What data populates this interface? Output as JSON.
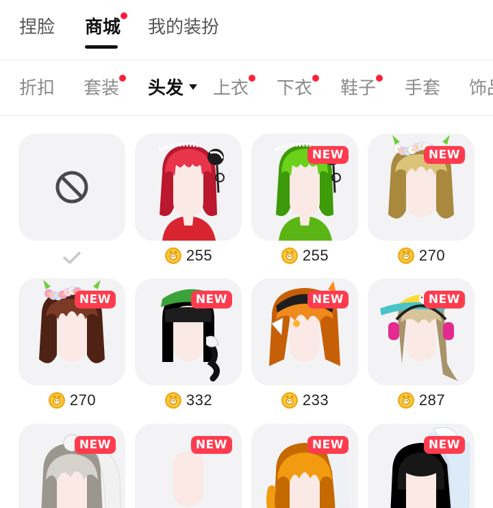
{
  "top_tabs": [
    {
      "label": "捏脸",
      "active": false,
      "dot": false
    },
    {
      "label": "商城",
      "active": true,
      "dot": true
    },
    {
      "label": "我的装扮",
      "active": false,
      "dot": false
    }
  ],
  "category_tabs": [
    {
      "label": "折扣",
      "active": false,
      "dot": false
    },
    {
      "label": "套装",
      "active": false,
      "dot": true
    },
    {
      "label": "头发",
      "active": true,
      "dot": false
    },
    {
      "label": "上衣",
      "active": false,
      "dot": true
    },
    {
      "label": "下衣",
      "active": false,
      "dot": true
    },
    {
      "label": "鞋子",
      "active": false,
      "dot": true
    },
    {
      "label": "手套",
      "active": false,
      "dot": false
    },
    {
      "label": "饰品",
      "active": false,
      "dot": false
    }
  ],
  "new_badge": "NEW",
  "colors": {
    "accent_red": "#ff3b4e",
    "dot_red": "#ff1f3d",
    "coin": "#f5b324"
  },
  "items": [
    {
      "kind": "none",
      "selected": true,
      "icon": "prohibited-icon"
    },
    {
      "kind": "hair",
      "price": "255",
      "new": false,
      "hair_color": "#e8354a",
      "hair_dark": "#b9182e",
      "style": "red-ponytail-maid",
      "shirt": "#d8242f"
    },
    {
      "kind": "hair",
      "price": "255",
      "new": true,
      "hair_color": "#6bd11b",
      "hair_dark": "#3d9a08",
      "style": "green-ponytail-maid",
      "shirt": "#5bb514"
    },
    {
      "kind": "hair",
      "price": "270",
      "new": true,
      "hair_color": "#dcc37a",
      "hair_dark": "#a8893e",
      "style": "blonde-flower-crown"
    },
    {
      "kind": "hair",
      "price": "270",
      "new": true,
      "hair_color": "#7a3a24",
      "hair_dark": "#4e2214",
      "style": "brown-flower-crown"
    },
    {
      "kind": "hair",
      "price": "332",
      "new": true,
      "hair_color": "#1d1d1d",
      "hair_dark": "#000000",
      "style": "black-green-kerchief-braid"
    },
    {
      "kind": "hair",
      "price": "233",
      "new": true,
      "hair_color": "#f08a1c",
      "hair_dark": "#c75f06",
      "style": "orange-beanie-clips"
    },
    {
      "kind": "hair",
      "price": "287",
      "new": true,
      "hair_color": "#d8c49a",
      "hair_dark": "#a8936a",
      "style": "blonde-cap-headphones"
    },
    {
      "kind": "hair",
      "price": "",
      "new": true,
      "hair_color": "#d6d2cc",
      "hair_dark": "#9b968e",
      "style": "grey-wavy-veil"
    },
    {
      "kind": "hair",
      "price": "",
      "new": true,
      "hair_color": "#e6e4e2",
      "hair_dark": "#9c9a98",
      "style": "silver-long-pearls"
    },
    {
      "kind": "hair",
      "price": "",
      "new": true,
      "hair_color": "#f29a10",
      "hair_dark": "#c46a00",
      "style": "orange-curly-veil"
    },
    {
      "kind": "hair",
      "price": "",
      "new": true,
      "hair_color": "#171717",
      "hair_dark": "#000000",
      "style": "black-bob-veil"
    }
  ]
}
